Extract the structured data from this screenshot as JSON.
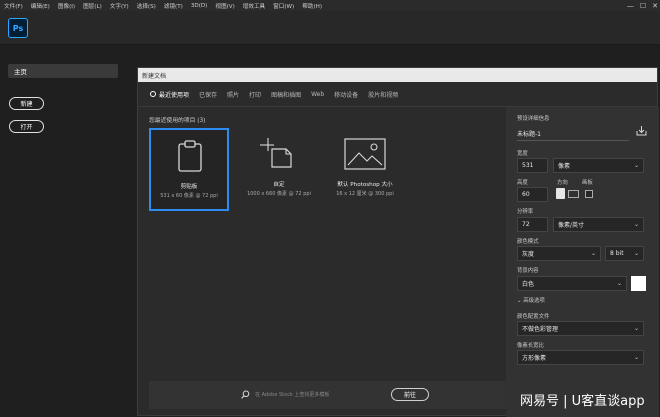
{
  "menu": [
    "文件(F)",
    "编辑(E)",
    "图像(I)",
    "图层(L)",
    "文字(Y)",
    "选择(S)",
    "滤镜(T)",
    "3D(D)",
    "视图(V)",
    "增效工具",
    "窗口(W)",
    "帮助(H)"
  ],
  "app": {
    "logo": "Ps"
  },
  "left": {
    "home": "主页",
    "new": "新建",
    "open": "打开"
  },
  "dialog": {
    "title": "新建文档",
    "tabs": [
      "最近使用项",
      "已保存",
      "照片",
      "打印",
      "图稿和插图",
      "Web",
      "移动设备",
      "胶片和视频"
    ],
    "recent_label": "您最近使用的项目 (3)",
    "presets": [
      {
        "name": "剪贴板",
        "dims": "531 x 60 像素 @ 72 ppi"
      },
      {
        "name": "自定",
        "dims": "1000 x 660 像素 @ 72 ppi"
      },
      {
        "name": "默认 Photoshop 大小",
        "dims": "16 x 12 厘米 @ 300 ppi"
      }
    ],
    "search_placeholder": "在 Adobe Stock 上查找更多模板",
    "go": "前往"
  },
  "details": {
    "header": "预设详细信息",
    "doc_name": "未标题-1",
    "width_label": "宽度",
    "width_value": "531",
    "width_unit": "像素",
    "height_label": "高度",
    "orientation_label": "方向",
    "artboard_label": "画板",
    "height_value": "60",
    "resolution_label": "分辨率",
    "resolution_value": "72",
    "resolution_unit": "像素/英寸",
    "color_mode_label": "颜色模式",
    "color_mode": "灰度",
    "bit_depth": "8 bit",
    "bg_label": "背景内容",
    "bg_value": "白色",
    "advanced": "高级选项",
    "profile_label": "颜色配置文件",
    "profile_value": "不做色彩管理",
    "aspect_label": "像素长宽比",
    "aspect_value": "方形像素"
  },
  "watermark": "网易号 | U客直谈app"
}
